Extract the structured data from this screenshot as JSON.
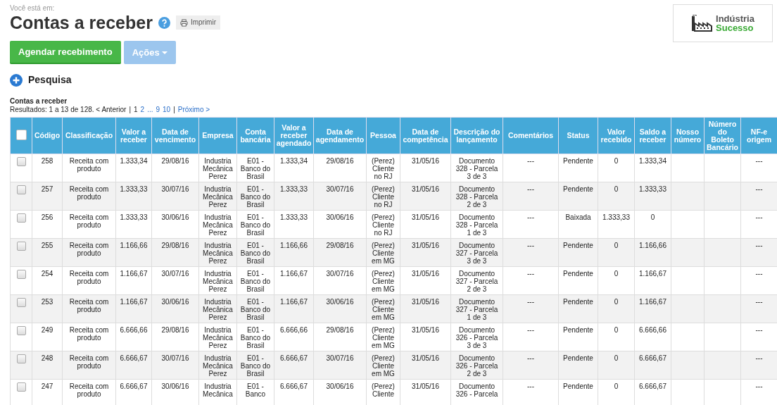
{
  "breadcrumb": "Você está em:",
  "title": "Contas a receber",
  "print_button": "Imprimir",
  "logo": {
    "line1": "Indústria",
    "line2": "Sucesso"
  },
  "buttons": [
    {
      "kind": "primary",
      "label": "Agendar recebimento"
    },
    {
      "kind": "dropdown",
      "label": "Ações",
      "disabled": true
    }
  ],
  "search_toggle": {
    "label": "Pesquisa",
    "expanded": false
  },
  "table_title": "Contas a receber",
  "pagination": [
    {
      "kind": "text",
      "text": "Resultados: 1 a 13 de 128. < Anterior"
    },
    {
      "kind": "sep",
      "text": "|"
    },
    {
      "kind": "page",
      "text": "1",
      "selected": true
    },
    {
      "kind": "page",
      "text": "2",
      "selected": false
    },
    {
      "kind": "page",
      "text": "...",
      "selected": false
    },
    {
      "kind": "page",
      "text": "9",
      "selected": false
    },
    {
      "kind": "page",
      "text": "10",
      "selected": false
    },
    {
      "kind": "sep",
      "text": "|"
    },
    {
      "kind": "link",
      "text": "Próximo >"
    }
  ],
  "select_all_checked": false,
  "columns": [
    "Código",
    "Classificação",
    "Valor a receber",
    "Data de vencimento",
    "Empresa",
    "Conta bancária",
    "Valor a receber agendado",
    "Data de agendamento",
    "Pessoa",
    "Data de competência",
    "Descrição do lançamento",
    "Comentários",
    "Status",
    "Valor recebido",
    "Saldo a receber",
    "Nosso número",
    "Número do Boleto Bancário",
    "NF-e origem"
  ],
  "rows": [
    {
      "checked": false,
      "cells": [
        "258",
        "Receita com produto",
        "1.333,34",
        "29/08/16",
        "Industria Mecânica Perez",
        "E01 - Banco do Brasil",
        "1.333,34",
        "29/08/16",
        "(Perez) Cliente no RJ",
        "31/05/16",
        "Documento 328 - Parcela 3 de 3",
        "---",
        "Pendente",
        "0",
        "1.333,34",
        null,
        null,
        "---"
      ]
    },
    {
      "checked": false,
      "cells": [
        "257",
        "Receita com produto",
        "1.333,33",
        "30/07/16",
        "Industria Mecânica Perez",
        "E01 - Banco do Brasil",
        "1.333,33",
        "30/07/16",
        "(Perez) Cliente no RJ",
        "31/05/16",
        "Documento 328 - Parcela 2 de 3",
        "---",
        "Pendente",
        "0",
        "1.333,33",
        null,
        null,
        "---"
      ]
    },
    {
      "checked": false,
      "cells": [
        "256",
        "Receita com produto",
        "1.333,33",
        "30/06/16",
        "Industria Mecânica Perez",
        "E01 - Banco do Brasil",
        "1.333,33",
        "30/06/16",
        "(Perez) Cliente no RJ",
        "31/05/16",
        "Documento 328 - Parcela 1 de 3",
        "---",
        "Baixada",
        "1.333,33",
        "0",
        null,
        null,
        "---"
      ]
    },
    {
      "checked": false,
      "cells": [
        "255",
        "Receita com produto",
        "1.166,66",
        "29/08/16",
        "Industria Mecânica Perez",
        "E01 - Banco do Brasil",
        "1.166,66",
        "29/08/16",
        "(Perez) Cliente em MG",
        "31/05/16",
        "Documento 327 - Parcela 3 de 3",
        "---",
        "Pendente",
        "0",
        "1.166,66",
        null,
        null,
        "---"
      ]
    },
    {
      "checked": false,
      "cells": [
        "254",
        "Receita com produto",
        "1.166,67",
        "30/07/16",
        "Industria Mecânica Perez",
        "E01 - Banco do Brasil",
        "1.166,67",
        "30/07/16",
        "(Perez) Cliente em MG",
        "31/05/16",
        "Documento 327 - Parcela 2 de 3",
        "---",
        "Pendente",
        "0",
        "1.166,67",
        null,
        null,
        "---"
      ]
    },
    {
      "checked": false,
      "cells": [
        "253",
        "Receita com produto",
        "1.166,67",
        "30/06/16",
        "Industria Mecânica Perez",
        "E01 - Banco do Brasil",
        "1.166,67",
        "30/06/16",
        "(Perez) Cliente em MG",
        "31/05/16",
        "Documento 327 - Parcela 1 de 3",
        "---",
        "Pendente",
        "0",
        "1.166,67",
        null,
        null,
        "---"
      ]
    },
    {
      "checked": false,
      "cells": [
        "249",
        "Receita com produto",
        "6.666,66",
        "29/08/16",
        "Industria Mecânica Perez",
        "E01 - Banco do Brasil",
        "6.666,66",
        "29/08/16",
        "(Perez) Cliente em MG",
        "31/05/16",
        "Documento 326 - Parcela 3 de 3",
        "---",
        "Pendente",
        "0",
        "6.666,66",
        null,
        null,
        "---"
      ]
    },
    {
      "checked": false,
      "cells": [
        "248",
        "Receita com produto",
        "6.666,67",
        "30/07/16",
        "Industria Mecânica Perez",
        "E01 - Banco do Brasil",
        "6.666,67",
        "30/07/16",
        "(Perez) Cliente em MG",
        "31/05/16",
        "Documento 326 - Parcela 2 de 3",
        "---",
        "Pendente",
        "0",
        "6.666,67",
        null,
        null,
        "---"
      ]
    },
    {
      "checked": false,
      "cells": [
        "247",
        "Receita com produto",
        "6.666,67",
        "30/06/16",
        "Industria Mecânica",
        "E01 - Banco",
        "6.666,67",
        "30/06/16",
        "(Perez) Cliente",
        "31/05/16",
        "Documento 326 - Parcela",
        "---",
        "Pendente",
        "0",
        "6.666,67",
        null,
        null,
        "---"
      ]
    }
  ]
}
